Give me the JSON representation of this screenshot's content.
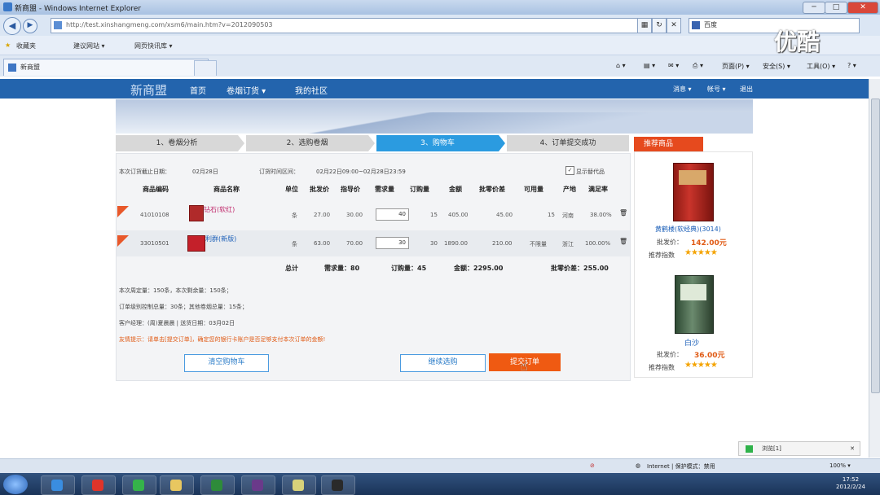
{
  "window": {
    "title": "新商盟 - Windows Internet Explorer"
  },
  "address": {
    "url": "http://test.xinshangmeng.com/xsm6/main.htm?v=2012090503",
    "search_placeholder": "百度"
  },
  "favorites": {
    "label": "收藏夹",
    "items": [
      "建议网站 ▾",
      "网页快讯库 ▾"
    ]
  },
  "tab": {
    "label": "新商盟"
  },
  "commandbar": {
    "page": "页面(P) ▾",
    "safety": "安全(S) ▾",
    "tools": "工具(O) ▾",
    "help": "? ▾"
  },
  "site": {
    "logo": "新商盟",
    "nav": [
      "首页",
      "卷烟订货 ▾",
      "我的社区"
    ],
    "right_nav": [
      "消息 ▾",
      "帐号 ▾",
      "退出"
    ]
  },
  "steps": [
    "1、卷烟分析",
    "2、选购卷烟",
    "3、购物车",
    "4、订单提交成功"
  ],
  "order_info": {
    "deadline_label": "本次订货截止日期：",
    "deadline": "02月28日",
    "time_label": "订货时间区间：",
    "time_range": "02月22日09:00~02月28日23:59",
    "show_alt": "显示替代品"
  },
  "table": {
    "headers": [
      "商品编码",
      "商品名称",
      "单位",
      "批发价",
      "指导价",
      "需求量",
      "订购量",
      "金额",
      "批零价差",
      "可用量",
      "产地",
      "满足率"
    ],
    "rows": [
      {
        "code": "41010108",
        "name": "钻石(软红)",
        "unit": "条",
        "wholesale": "27.00",
        "guide": "30.00",
        "demand": "40",
        "order": "15",
        "amount": "405.00",
        "diff": "45.00",
        "available": "15",
        "origin": "河南",
        "rate": "38.00%"
      },
      {
        "code": "33010501",
        "name": "利群(新版)",
        "unit": "条",
        "wholesale": "63.00",
        "guide": "70.00",
        "demand": "30",
        "order": "30",
        "amount": "1890.00",
        "diff": "210.00",
        "available": "不限量",
        "origin": "浙江",
        "rate": "100.00%"
      }
    ],
    "totals": {
      "label": "总计",
      "demand": "需求量：80",
      "order": "订购量：45",
      "amount": "金额：2295.00",
      "diff": "批零价差：255.00"
    }
  },
  "notes": [
    "本次周定量：150条，本次剩余量：150条；",
    "订单级别控制总量：30条；其他卷烟总量：15条；",
    "客户经理：(周)夏晨晨 | 送货日期：03月02日"
  ],
  "warning": "友情提示：请单击[提交订单]，确定您的银行卡账户是否足够支付本次订单的金额!",
  "buttons": {
    "clear": "清空购物车",
    "continue": "继续选购",
    "submit": "提交订单"
  },
  "recommend": {
    "title": "推荐商品",
    "items": [
      {
        "name": "黄鹤楼(软经典)(3014)",
        "price_label": "批发价：",
        "price": "142.00元",
        "rating_label": "推荐指数"
      },
      {
        "name": "白沙",
        "price_label": "批发价：",
        "price": "36.00元",
        "rating_label": "推荐指数"
      }
    ]
  },
  "statusbar": {
    "zone": "Internet | 保护模式：禁用",
    "zoom": "100% ▾"
  },
  "popup": {
    "text": "浏览[1]"
  },
  "clock": {
    "time": "17:52",
    "date": "2012/2/24"
  },
  "watermark": "优酷",
  "colors": {
    "accent": "#2b9be0",
    "header": "#2364ad",
    "orange": "#ef5a12"
  }
}
